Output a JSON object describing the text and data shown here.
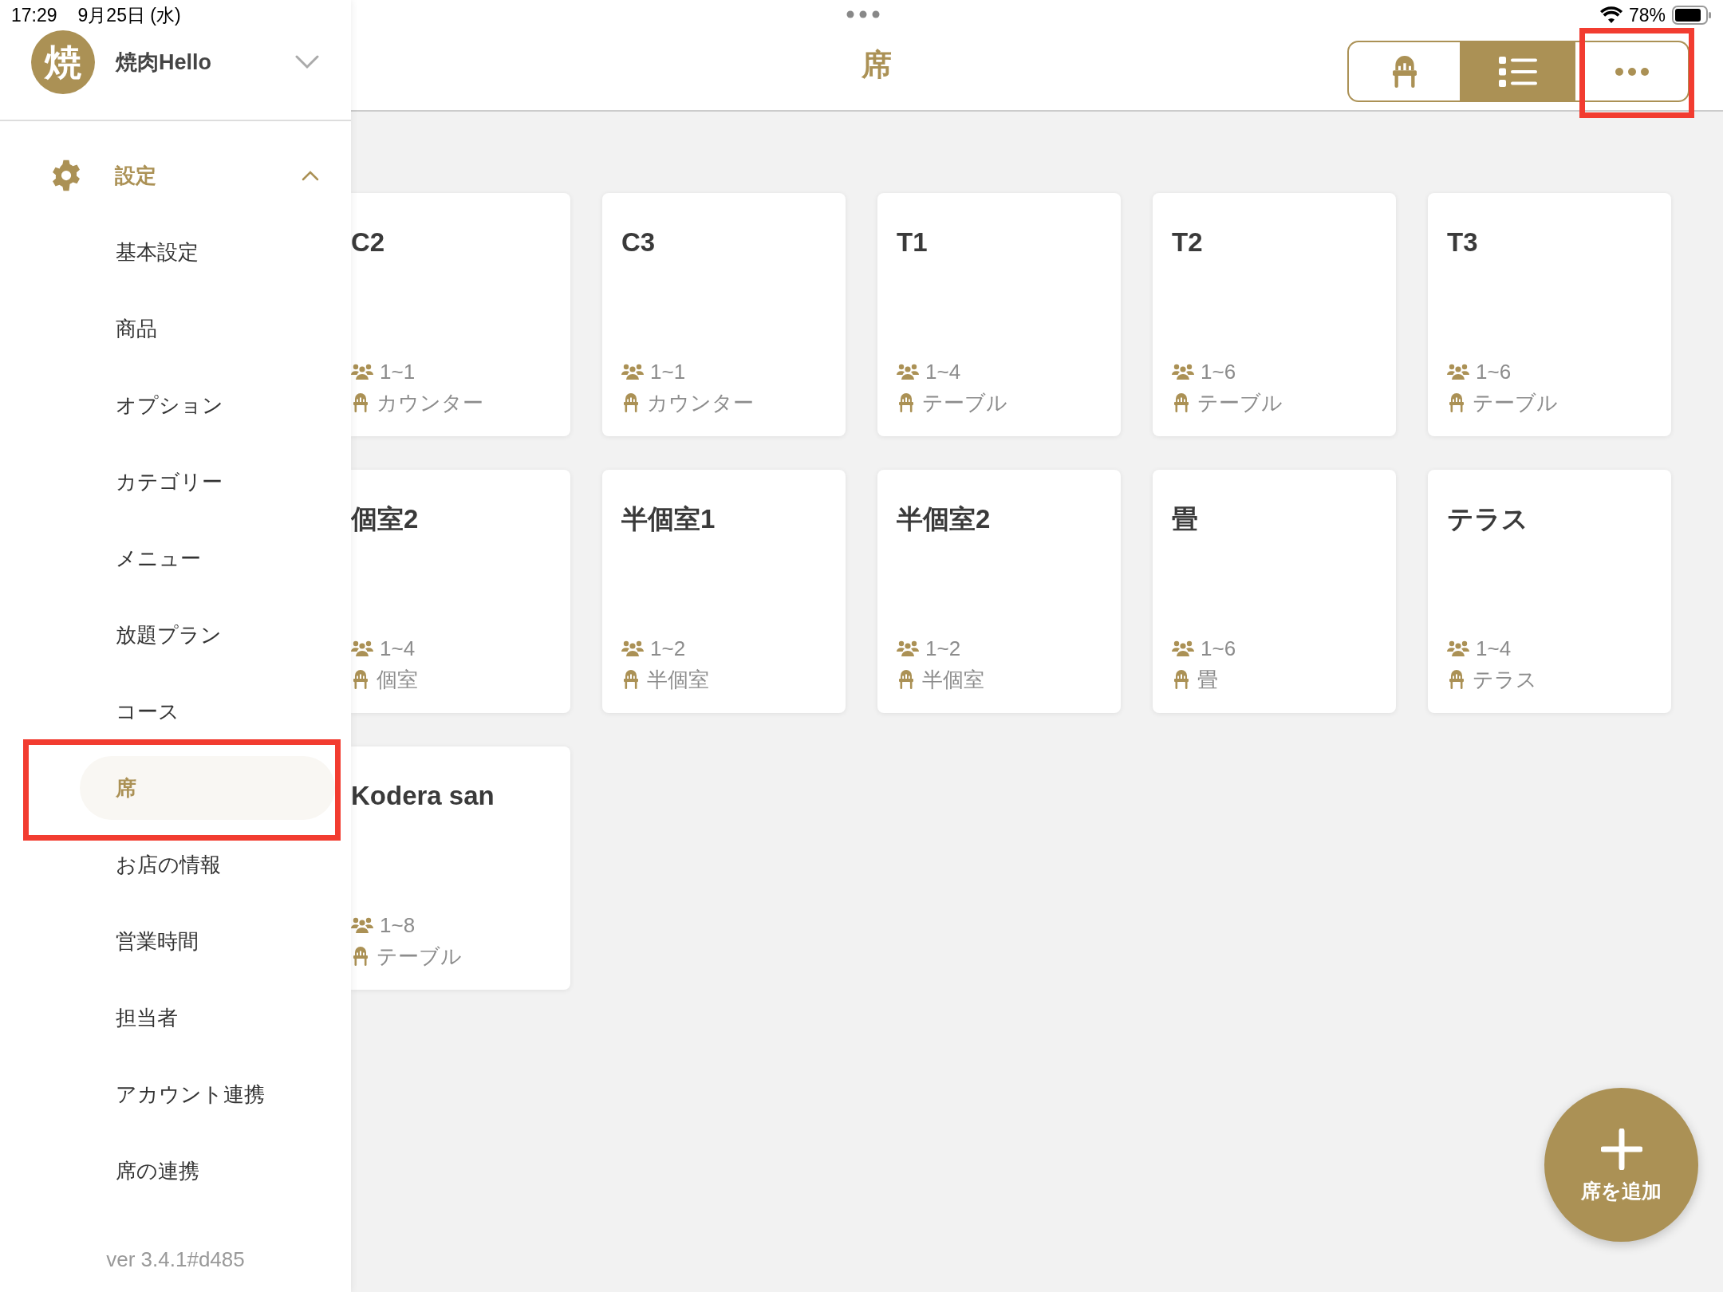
{
  "status_bar": {
    "time": "17:29",
    "date": "9月25日 (水)",
    "battery": "78%"
  },
  "drawer": {
    "avatar": "焼",
    "shop_name": "焼肉Hello",
    "section": {
      "label": "設定",
      "expanded": true
    },
    "items": [
      {
        "label": "基本設定",
        "selected": false,
        "highlight": false
      },
      {
        "label": "商品",
        "selected": false,
        "highlight": false
      },
      {
        "label": "オプション",
        "selected": false,
        "highlight": false
      },
      {
        "label": "カテゴリー",
        "selected": false,
        "highlight": false
      },
      {
        "label": "メニュー",
        "selected": false,
        "highlight": false
      },
      {
        "label": "放題プラン",
        "selected": false,
        "highlight": false
      },
      {
        "label": "コース",
        "selected": false,
        "highlight": false
      },
      {
        "label": "席",
        "selected": true,
        "highlight": true
      },
      {
        "label": "お店の情報",
        "selected": false,
        "highlight": false
      },
      {
        "label": "営業時間",
        "selected": false,
        "highlight": false
      },
      {
        "label": "担当者",
        "selected": false,
        "highlight": false
      },
      {
        "label": "アカウント連携",
        "selected": false,
        "highlight": false
      },
      {
        "label": "席の連携",
        "selected": false,
        "highlight": false
      }
    ],
    "version": "ver 3.4.1#d485"
  },
  "header": {
    "title": "席",
    "view_modes": [
      {
        "kind": "seat",
        "selected": false,
        "highlight": false
      },
      {
        "kind": "list",
        "selected": true,
        "highlight": false
      },
      {
        "kind": "more",
        "selected": false,
        "highlight": true
      }
    ]
  },
  "seats": [
    {
      "name": "C2",
      "capacity": "1~1",
      "type": "カウンター"
    },
    {
      "name": "C3",
      "capacity": "1~1",
      "type": "カウンター"
    },
    {
      "name": "T1",
      "capacity": "1~4",
      "type": "テーブル"
    },
    {
      "name": "T2",
      "capacity": "1~6",
      "type": "テーブル"
    },
    {
      "name": "T3",
      "capacity": "1~6",
      "type": "テーブル"
    },
    {
      "name": "個室2",
      "capacity": "1~4",
      "type": "個室"
    },
    {
      "name": "半個室1",
      "capacity": "1~2",
      "type": "半個室"
    },
    {
      "name": "半個室2",
      "capacity": "1~2",
      "type": "半個室"
    },
    {
      "name": "畳",
      "capacity": "1~6",
      "type": "畳"
    },
    {
      "name": "テラス",
      "capacity": "1~4",
      "type": "テラス"
    },
    {
      "name": "Kodera san",
      "capacity": "1~8",
      "type": "テーブル"
    }
  ],
  "add_button": {
    "label": "席を追加"
  }
}
